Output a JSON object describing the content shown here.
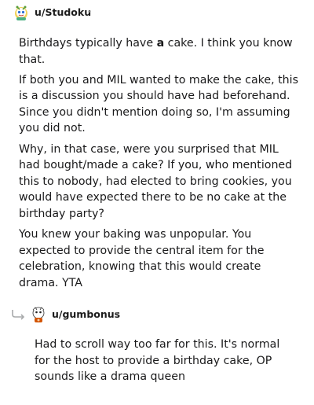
{
  "comments": [
    {
      "username": "u/Studoku",
      "separator": "•",
      "avatar_icon": "snoo-avatar-icon",
      "paragraphs": [
        {
          "before": "Birthdays typically have ",
          "bold": "a",
          "after": " cake. I think you know that."
        },
        {
          "text": "If both you and MIL wanted to make the cake, this is a discussion you should have had beforehand. Since you didn't mention doing so, I'm assuming you did not."
        },
        {
          "text": "Why, in that case, were you surprised that MIL had bought/made a cake? If you, who mentioned this to nobody, had elected to bring cookies, you would have expected there to be no cake at the birthday party?"
        },
        {
          "text": "You knew your baking was unpopular. You expected to provide the central item for the celebration, knowing that this would create drama. YTA"
        }
      ]
    },
    {
      "username": "u/gumbonus",
      "separator": "•",
      "avatar_icon": "snoo-avatar-icon",
      "reply_icon": "reply-arrow-icon",
      "paragraphs": [
        {
          "text": "Had to scroll way too far for this. It's normal for the host to provide a birthday cake, OP sounds like a drama queen"
        }
      ]
    }
  ]
}
